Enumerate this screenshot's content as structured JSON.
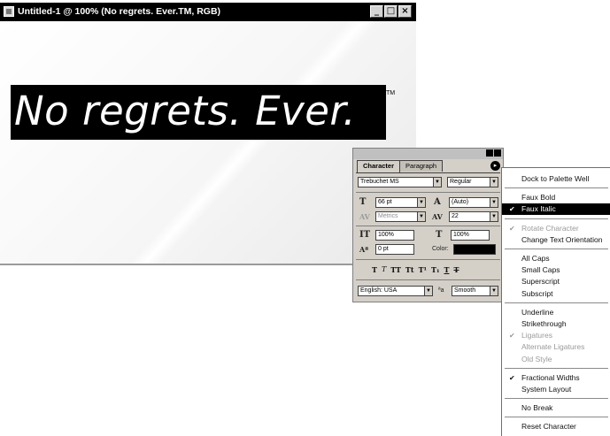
{
  "window": {
    "title": "Untitled-1 @ 100% (No regrets. Ever.TM, RGB)",
    "btn_min": "_",
    "btn_max": "□",
    "btn_close": "×"
  },
  "canvas": {
    "headline": "No regrets. Ever.",
    "tm": "TM"
  },
  "palette": {
    "tabs": [
      "Character",
      "Paragraph"
    ],
    "menu_arrow": "▸",
    "font_family": "Trebuchet MS",
    "font_style": "Regular",
    "font_size": "66 pt",
    "leading": "(Auto)",
    "kerning": "Metrics",
    "tracking": "22",
    "vertical_scale": "100%",
    "horizontal_scale": "100%",
    "baseline_shift": "0 pt",
    "color_label": "Color:",
    "color_value": "#000000",
    "style_buttons": [
      "T",
      "T",
      "TT",
      "Tt",
      "T¹",
      "T₁",
      "T",
      "T"
    ],
    "language": "English: USA",
    "antialias_label": "ªa",
    "antialias": "Smooth"
  },
  "menu": {
    "groups": [
      [
        {
          "label": "Dock to Palette Well",
          "checked": false,
          "disabled": false
        }
      ],
      [
        {
          "label": "Faux Bold",
          "checked": false,
          "disabled": false
        },
        {
          "label": "Faux Italic",
          "checked": true,
          "disabled": false,
          "selected": true
        }
      ],
      [
        {
          "label": "Rotate Character",
          "checked": true,
          "disabled": true
        },
        {
          "label": "Change Text Orientation",
          "checked": false,
          "disabled": false
        }
      ],
      [
        {
          "label": "All Caps",
          "checked": false,
          "disabled": false
        },
        {
          "label": "Small Caps",
          "checked": false,
          "disabled": false
        },
        {
          "label": "Superscript",
          "checked": false,
          "disabled": false
        },
        {
          "label": "Subscript",
          "checked": false,
          "disabled": false
        }
      ],
      [
        {
          "label": "Underline",
          "checked": false,
          "disabled": false
        },
        {
          "label": "Strikethrough",
          "checked": false,
          "disabled": false
        },
        {
          "label": "Ligatures",
          "checked": true,
          "disabled": true
        },
        {
          "label": "Alternate Ligatures",
          "checked": false,
          "disabled": true
        },
        {
          "label": "Old Style",
          "checked": false,
          "disabled": true
        }
      ],
      [
        {
          "label": "Fractional Widths",
          "checked": true,
          "disabled": false
        },
        {
          "label": "System Layout",
          "checked": false,
          "disabled": false
        }
      ],
      [
        {
          "label": "No Break",
          "checked": false,
          "disabled": false
        }
      ],
      [
        {
          "label": "Reset Character",
          "checked": false,
          "disabled": false
        }
      ]
    ]
  }
}
